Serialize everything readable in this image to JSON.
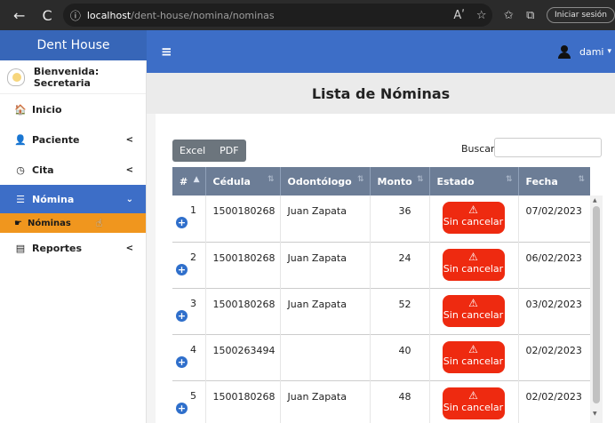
{
  "browser": {
    "back_icon": "←",
    "refresh_icon": "C",
    "info_icon": "ⓘ",
    "url_host": "localhost",
    "url_path": "/dent-house/nomina/nominas",
    "read_icon": "Aʹ",
    "fav_icon": "☆",
    "collections_icon": "✩",
    "split_icon": "⧉",
    "signin_label": "Iniciar sesión"
  },
  "app": {
    "brand": "Dent House",
    "hamburger_icon": "≡",
    "user_name": "dami",
    "user_caret": "▾"
  },
  "sidebar": {
    "welcome": "Bienvenida: Secretaria",
    "items": [
      {
        "label": "Inicio",
        "icon": "🏠"
      },
      {
        "label": "Paciente",
        "icon": "👤",
        "chevron": "<"
      },
      {
        "label": "Cita",
        "icon": "◷",
        "chevron": "<"
      },
      {
        "label": "Nómina",
        "icon": "☰",
        "chevron": "⌄"
      },
      {
        "label": "Reportes",
        "icon": "▤",
        "chevron": "<"
      }
    ],
    "submenu": {
      "label": "Nóminas",
      "icon": "☛",
      "cursor": "☝"
    }
  },
  "page": {
    "title": "Lista de Nóminas",
    "btn_excel": "Excel",
    "btn_pdf": "PDF",
    "search_label": "Buscar",
    "search_value": ""
  },
  "table": {
    "headers": [
      "#",
      "Cédula",
      "Odontólogo",
      "Monto",
      "Estado",
      "Fecha"
    ],
    "rows": [
      {
        "num": "1",
        "cedula": "1500180268",
        "odontologo": "Juan Zapata",
        "monto": "36",
        "estado": "Sin cancelar",
        "fecha": "07/02/2023"
      },
      {
        "num": "2",
        "cedula": "1500180268",
        "odontologo": "Juan Zapata",
        "monto": "24",
        "estado": "Sin cancelar",
        "fecha": "06/02/2023"
      },
      {
        "num": "3",
        "cedula": "1500180268",
        "odontologo": "Juan Zapata",
        "monto": "52",
        "estado": "Sin cancelar",
        "fecha": "03/02/2023"
      },
      {
        "num": "4",
        "cedula": "1500263494",
        "odontologo": "",
        "monto": "40",
        "estado": "Sin cancelar",
        "fecha": "02/02/2023"
      },
      {
        "num": "5",
        "cedula": "1500180268",
        "odontologo": "Juan Zapata",
        "monto": "48",
        "estado": "Sin cancelar",
        "fecha": "02/02/2023"
      }
    ]
  },
  "colors": {
    "primary": "#3d6ec7",
    "active_submenu": "#f0961e",
    "status_red": "#ee2a10",
    "table_header": "#6c7d96"
  }
}
